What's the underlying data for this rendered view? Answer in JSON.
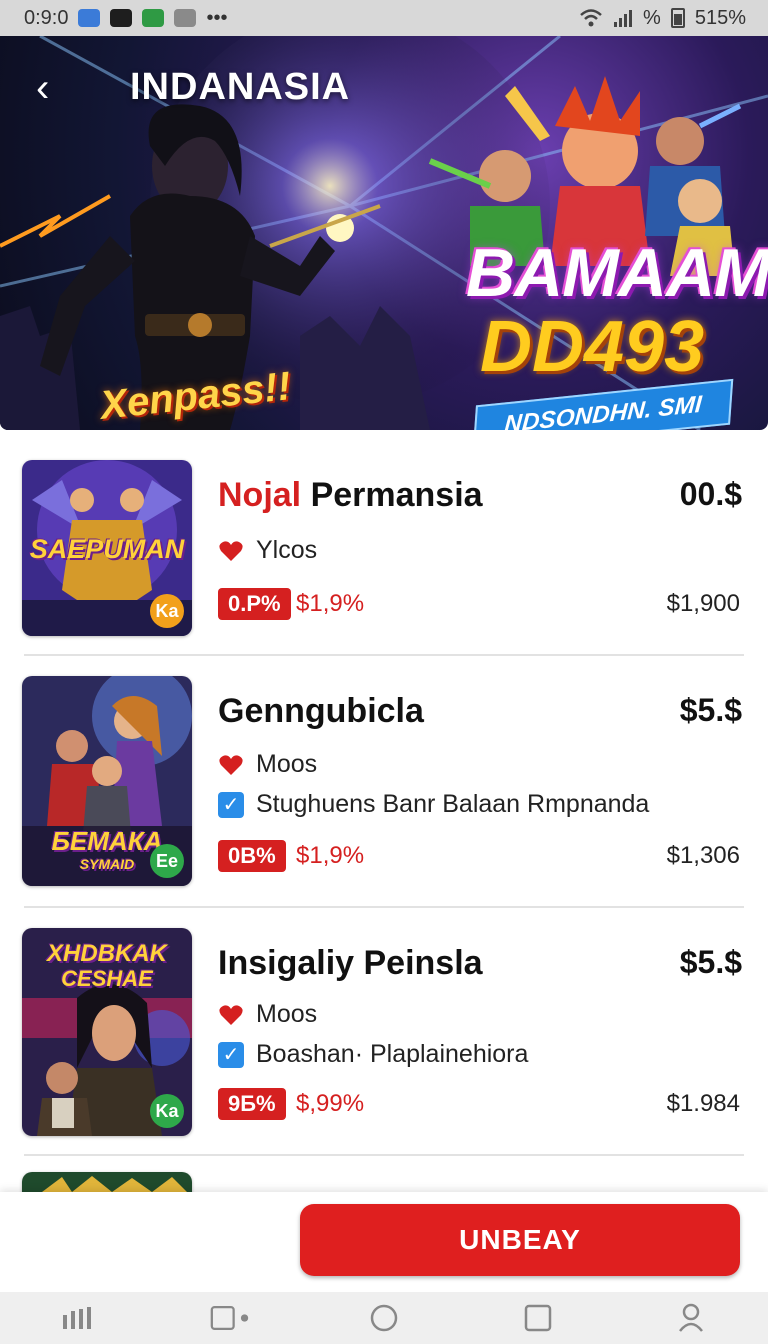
{
  "status_bar": {
    "time": "0:9:0",
    "dots": "•••",
    "signal_text": "%",
    "battery_text": "515%"
  },
  "hero": {
    "title": "INDANASIA",
    "word_left": "Xenpass!!",
    "brand_line_1": "BAMAAM",
    "brand_line_2": "DD493",
    "tag": "NDSONDHN. SMI"
  },
  "items": [
    {
      "title_accent": "Nojal",
      "title_rest": "Permansia",
      "price": "00.$",
      "meta_1": "Ylcos",
      "meta_2": "",
      "discount": "0.P%",
      "discount_price": "$1,9%",
      "sub_price": "$1,900",
      "thumb_caption": "SAEPUMAN",
      "thumb_badge": "Ka"
    },
    {
      "title_accent": "",
      "title_rest": "Genngubicla",
      "price": "$5.$",
      "meta_1": "Moos",
      "meta_2": "Stughuens Banr Balaan Rmpnanda",
      "discount": "0B%",
      "discount_price": "$1,9%",
      "sub_price": "$1,306",
      "thumb_caption": "БЕМАКА",
      "thumb_caption_2": "SYMAID",
      "thumb_badge": "Ee"
    },
    {
      "title_accent": "",
      "title_rest": "Insigaliy Peinsla",
      "price": "$5.$",
      "meta_1": "Moos",
      "meta_2": "Boashan· Plaplainehiora",
      "discount": "9Б%",
      "discount_price": "$,99%",
      "sub_price": "$1.984",
      "thumb_caption": "XHDBKAK",
      "thumb_caption_2": "CESHAE",
      "thumb_badge": "Ka"
    }
  ],
  "buy_button": {
    "label": "UNBEAY"
  },
  "colors": {
    "accent_red": "#d52020",
    "button_red": "#df1f1f",
    "check_blue": "#2a8de8",
    "badge_orange": "#f2a01b",
    "badge_green": "#2ea84a"
  },
  "icons": {
    "status": [
      "bluetooth-icon",
      "app-icon",
      "battery-saver-icon",
      "notification-icon",
      "wifi-icon",
      "signal-icon",
      "battery-icon"
    ],
    "nav": [
      "recents-icon",
      "square-icon",
      "home-icon",
      "overview-icon",
      "profile-icon"
    ]
  }
}
